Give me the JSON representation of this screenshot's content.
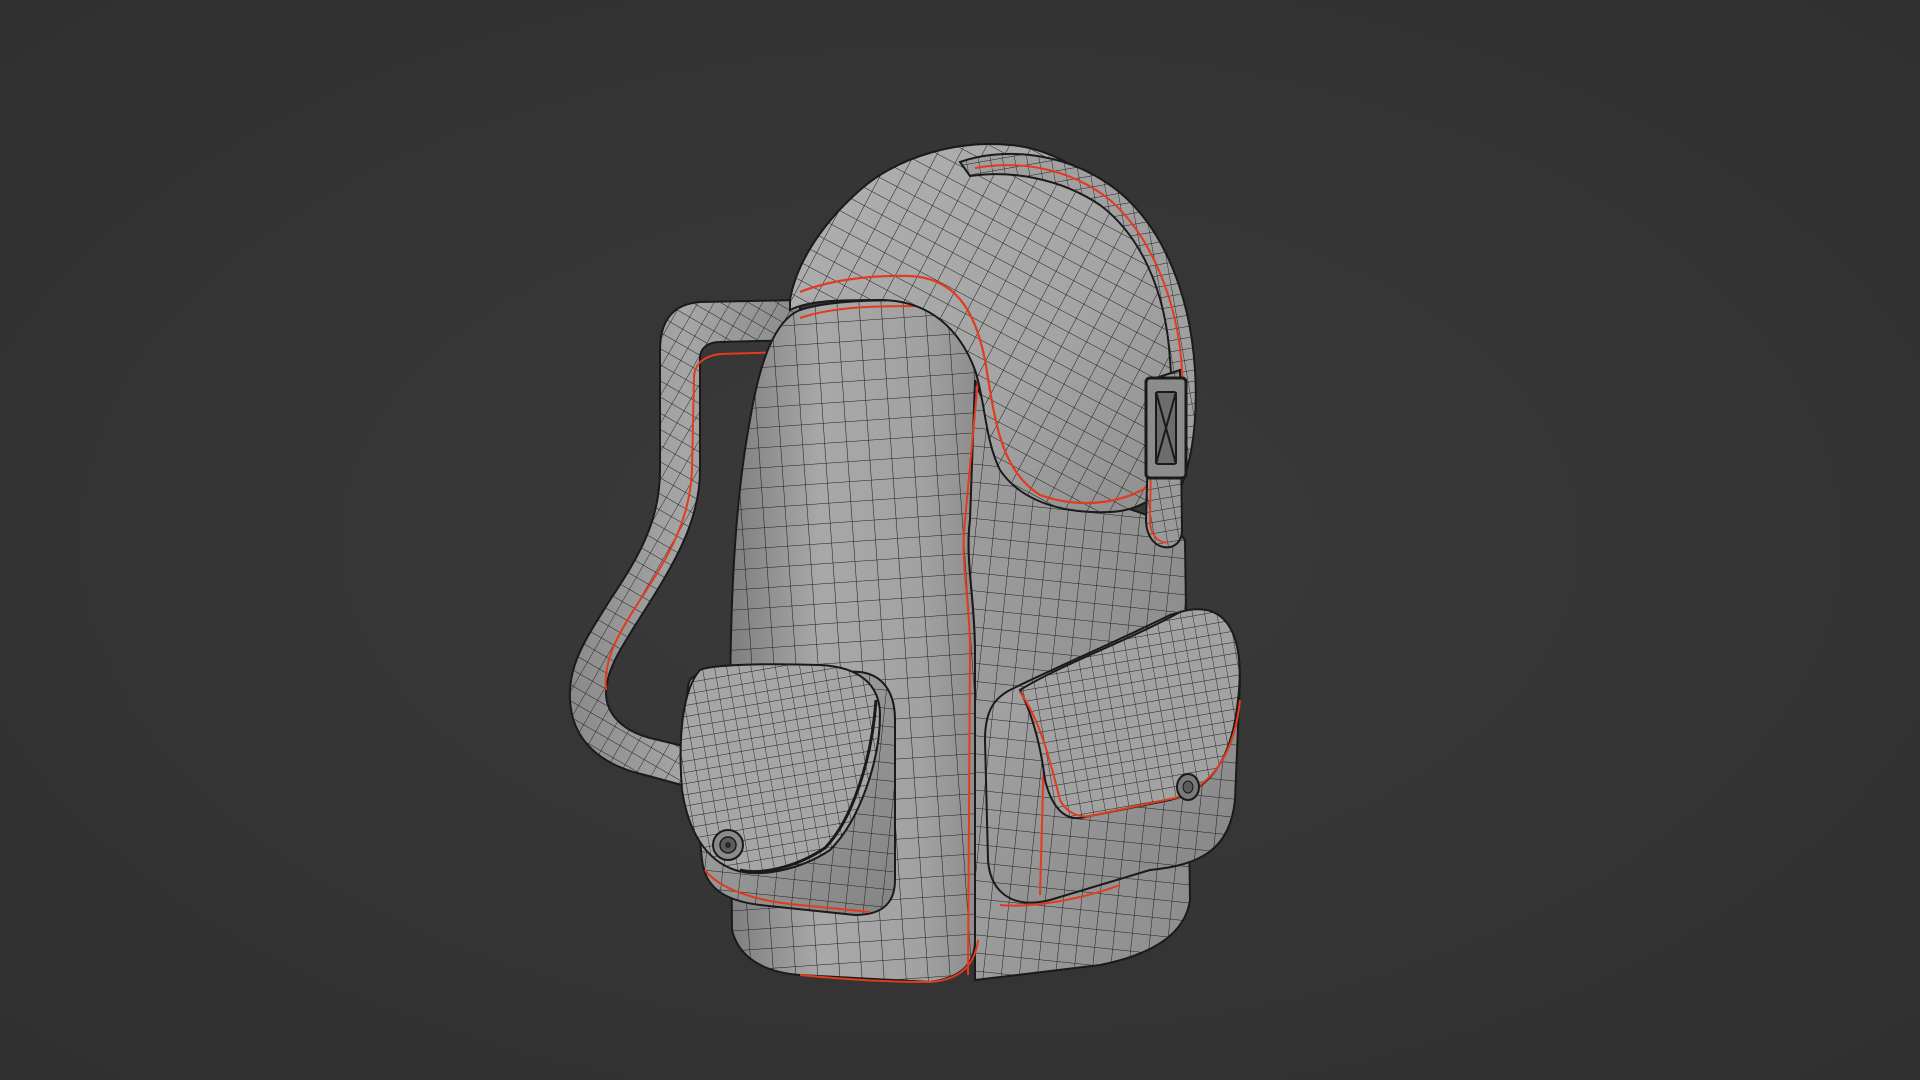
{
  "viewport": {
    "background_color": "#353535",
    "shading": "solid-wireframe",
    "mesh_surface_color": "#9c9c9c",
    "wire_color": "#1c1c1c",
    "seam_color": "#e23b1e"
  },
  "object": {
    "kind": "backpack-mesh",
    "parts": [
      "backpack-body-mesh",
      "top-flap-mesh",
      "side-handle-mesh",
      "left-pocket-mesh",
      "left-pocket-flap-mesh",
      "right-pocket-mesh",
      "right-pocket-flap-mesh",
      "strap-mesh",
      "strap-buckle",
      "pocket-button"
    ]
  }
}
